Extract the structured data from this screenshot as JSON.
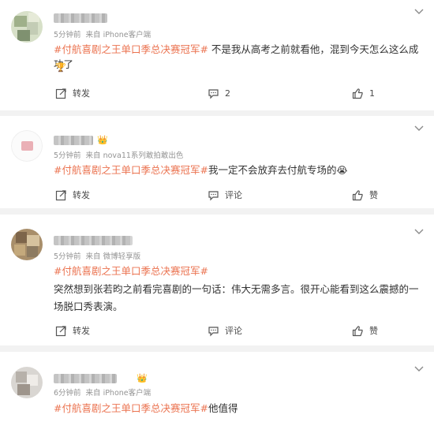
{
  "comments": [
    {
      "time": "5分钟前",
      "source": "来自 iPhone客户端",
      "hashtag": "#付航喜剧之王单口季总决赛冠军#",
      "text": " 不是我从高考之前就看他，混到今天怎么这么成功了",
      "extra_emoji": "trophy-icon",
      "forward": "转发",
      "comment_count": "2",
      "like_count": "1"
    },
    {
      "time": "5分钟前",
      "source": "来自 nova11系列敢拍敢出色",
      "hashtag": "#付航喜剧之王单口季总决赛冠军#",
      "text": "我一定不会放弃去付航专场的",
      "emoji": "😭",
      "forward": "转发",
      "comment_label": "评论",
      "like_label": "赞"
    },
    {
      "time": "5分钟前",
      "source": "来自 微博轻享版",
      "hashtag": "#付航喜剧之王单口季总决赛冠军#",
      "text": "突然想到张若昀之前看完喜剧的一句话：伟大无需多言。很开心能看到这么震撼的一场脱口秀表演。",
      "forward": "转发",
      "comment_label": "评论",
      "like_label": "赞"
    },
    {
      "time": "6分钟前",
      "source": "来自 iPhone客户端",
      "hashtag": "#付航喜剧之王单口季总决赛冠军#",
      "text": "他值得"
    }
  ],
  "colors": {
    "hashtag": "#eb7350",
    "meta": "#939393",
    "background": "#f2f2f2"
  }
}
